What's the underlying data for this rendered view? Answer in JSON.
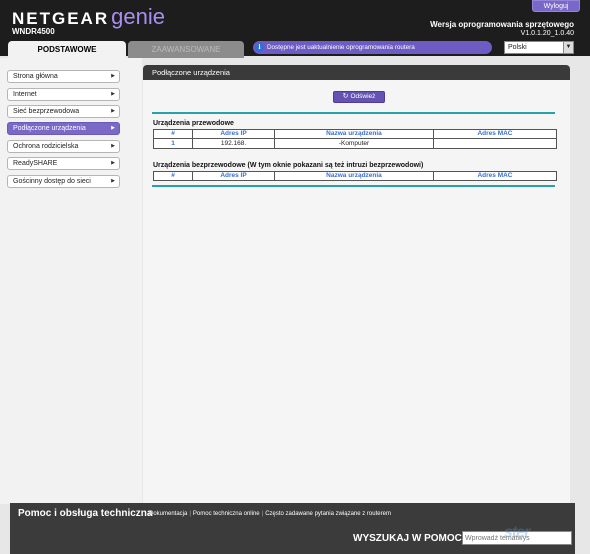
{
  "header": {
    "brand": "NETGEAR",
    "product": "genie",
    "model": "WNDR4500",
    "logout_label": "Wyloguj",
    "firmware_label": "Wersja oprogramowania sprzętowego",
    "firmware_version": "V1.0.1.20_1.0.40"
  },
  "tabs": {
    "basic": "PODSTAWOWE",
    "advanced": "ZAAWANSOWANE"
  },
  "update_banner": "Dostępne jest uaktualnienie oprogramowania routera",
  "language": "Polski",
  "sidebar": {
    "items": [
      {
        "label": "Strona główna"
      },
      {
        "label": "Internet"
      },
      {
        "label": "Sieć bezprzewodowa"
      },
      {
        "label": "Podłączone urządzenia"
      },
      {
        "label": "Ochrona rodzicielska"
      },
      {
        "label": "ReadySHARE"
      },
      {
        "label": "Gościnny dostęp do sieci"
      }
    ]
  },
  "main": {
    "title": "Podłączone urządzenia",
    "refresh_label": "Odśwież",
    "wired": {
      "title": "Urządzenia przewodowe",
      "columns": [
        "#",
        "Adres IP",
        "Nazwa urządzenia",
        "Adres MAC"
      ],
      "rows": [
        {
          "num": "1",
          "ip": "192.168.",
          "name": "-Komputer",
          "mac": ""
        }
      ]
    },
    "wireless": {
      "title": "Urządzenia bezprzewodowe (W tym oknie pokazani są też intruzi bezprzewodowi)",
      "columns": [
        "#",
        "Adres IP",
        "Nazwa urządzenia",
        "Adres MAC"
      ]
    }
  },
  "footer": {
    "help_title": "Pomoc i obsługa techniczna",
    "links": [
      "Dokumentacja",
      "Pomoc techniczna online",
      "Często zadawane pytania związane z routerem"
    ],
    "search_label": "WYSZUKAJ W POMOCY",
    "search_placeholder": "Wprowadź tematwys"
  },
  "watermark": "ster",
  "colors": {
    "accent": "#7a69c6",
    "header_bg": "#1d1d1d",
    "teal_line": "#2aa0a8",
    "table_header_text": "#3a6fd0"
  }
}
